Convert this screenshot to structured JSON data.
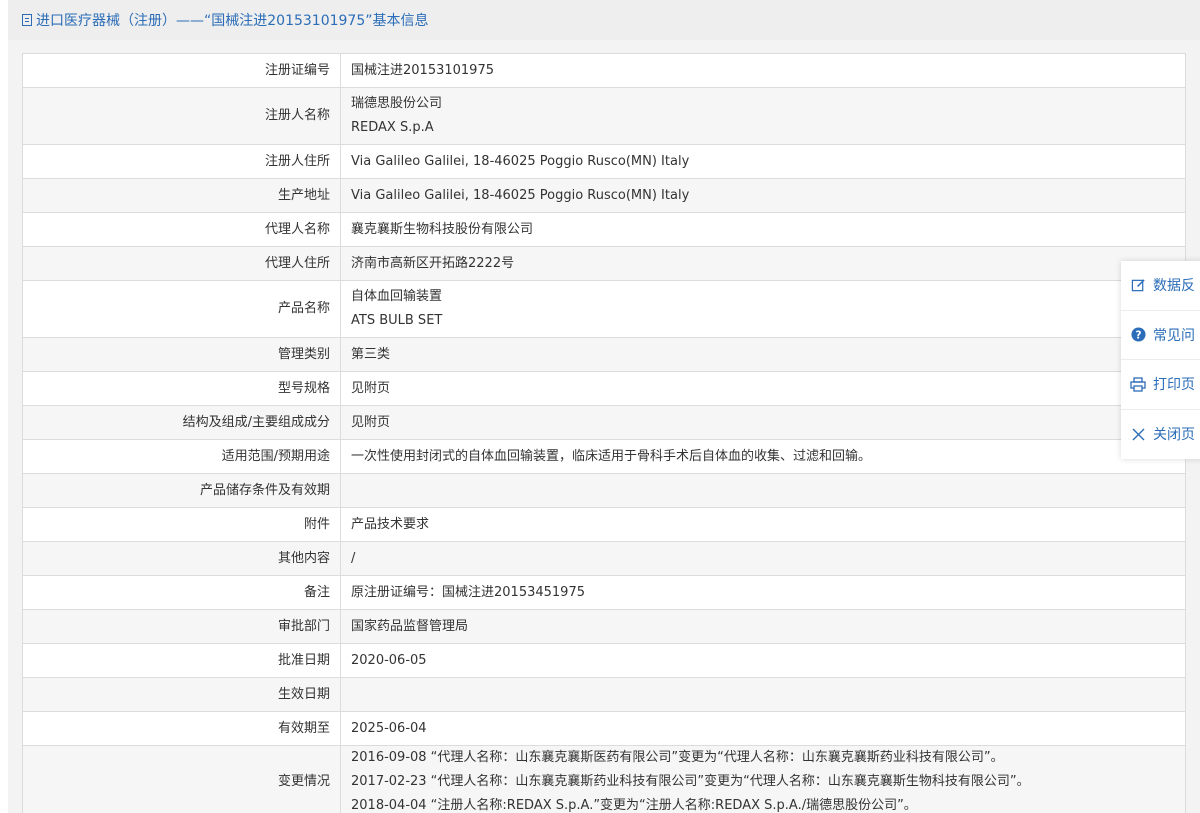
{
  "header": {
    "title": "进口医疗器械（注册）——“国械注进20153101975”基本信息"
  },
  "rows": [
    {
      "label": "注册证编号",
      "value": "国械注进20153101975"
    },
    {
      "label": "注册人名称",
      "lines": [
        "瑞德思股份公司",
        "REDAX S.p.A"
      ]
    },
    {
      "label": "注册人住所",
      "value": "Via Galileo Galilei, 18-46025 Poggio Rusco(MN) Italy"
    },
    {
      "label": "生产地址",
      "value": "Via Galileo Galilei, 18-46025 Poggio Rusco(MN) Italy"
    },
    {
      "label": "代理人名称",
      "value": "襄克襄斯生物科技股份有限公司"
    },
    {
      "label": "代理人住所",
      "value": "济南市高新区开拓路2222号"
    },
    {
      "label": "产品名称",
      "lines": [
        "自体血回输装置",
        "ATS BULB SET"
      ]
    },
    {
      "label": "管理类别",
      "value": "第三类"
    },
    {
      "label": "型号规格",
      "value": "见附页"
    },
    {
      "label": "结构及组成/主要组成成分",
      "value": "见附页"
    },
    {
      "label": "适用范围/预期用途",
      "value": "一次性使用封闭式的自体血回输装置，临床适用于骨科手术后自体血的收集、过滤和回输。"
    },
    {
      "label": "产品储存条件及有效期",
      "value": ""
    },
    {
      "label": "附件",
      "value": "产品技术要求"
    },
    {
      "label": "其他内容",
      "value": "/"
    },
    {
      "label": "备注",
      "value": "原注册证编号：国械注进20153451975"
    },
    {
      "label": "审批部门",
      "value": "国家药品监督管理局"
    },
    {
      "label": "批准日期",
      "value": "2020-06-05"
    },
    {
      "label": "生效日期",
      "value": ""
    },
    {
      "label": "有效期至",
      "value": "2025-06-04"
    },
    {
      "label": "变更情况",
      "lines": [
        "2016-09-08 “代理人名称：山东襄克襄斯医药有限公司”变更为“代理人名称：山东襄克襄斯药业科技有限公司”。",
        "2017-02-23 “代理人名称：山东襄克襄斯药业科技有限公司”变更为“代理人名称：山东襄克襄斯生物科技有限公司”。",
        "2018-04-04 “注册人名称:REDAX S.p.A.”变更为“注册人名称:REDAX S.p.A./瑞德思股份公司”。"
      ]
    }
  ],
  "float_menu": [
    {
      "label": "数据反",
      "icon": "edit-icon"
    },
    {
      "label": "常见问",
      "icon": "question-icon"
    },
    {
      "label": "打印页",
      "icon": "printer-icon"
    },
    {
      "label": "关闭页",
      "icon": "close-icon"
    }
  ]
}
